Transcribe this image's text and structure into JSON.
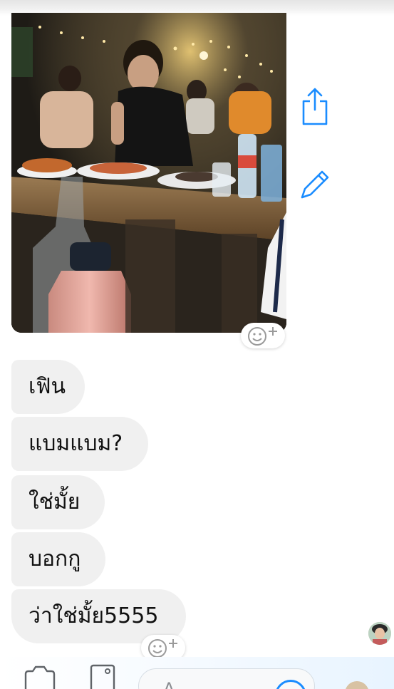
{
  "conversation": {
    "photo_message": {
      "share_icon": "share-icon",
      "edit_icon": "pencil-icon",
      "react_icon": "add-reaction-icon"
    },
    "messages": [
      {
        "text": "เฟิน"
      },
      {
        "text": "แบมแบม?"
      },
      {
        "text": "ใช่มั้ย"
      },
      {
        "text": "บอกกู"
      },
      {
        "text": "ว่าใช่มั้ย5555"
      }
    ],
    "last_message_react_icon": "add-reaction-icon",
    "seen_avatar": "avatar"
  },
  "composer": {
    "camera_icon": "camera-icon",
    "gallery_icon": "image-icon",
    "input_placeholder": "A",
    "emoji_icon": "emoji-icon"
  },
  "colors": {
    "accent": "#1a8cff",
    "bubble_bg": "#f0f0f0",
    "text": "#111111"
  }
}
